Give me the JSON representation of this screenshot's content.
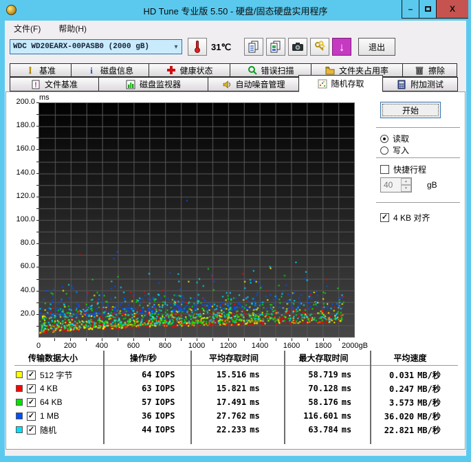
{
  "window": {
    "title": "HD Tune 专业版 5.50 - 硬盘/固态硬盘实用程序"
  },
  "titlebar_controls": {
    "minimize": "–",
    "maximize": "",
    "close": "X"
  },
  "menu": {
    "file": "文件(F)",
    "help": "帮助(H)"
  },
  "toolbar": {
    "drive_select_value": "WDC WD20EARX-00PASB0 (2000 gB)",
    "temperature": "31℃",
    "exit_label": "退出",
    "icons": [
      "thermometer-icon",
      "copy-text-icon",
      "copy-image-icon",
      "camera-icon",
      "keys-icon",
      "download-arrow-icon"
    ]
  },
  "tabs": {
    "row1": [
      {
        "label": "基准",
        "icon": "exclamation-icon"
      },
      {
        "label": "磁盘信息",
        "icon": "info-icon"
      },
      {
        "label": "健康状态",
        "icon": "health-cross-icon"
      },
      {
        "label": "错误扫描",
        "icon": "magnifier-icon"
      },
      {
        "label": "文件夹占用率",
        "icon": "folder-icon"
      },
      {
        "label": "擦除",
        "icon": "trash-icon"
      }
    ],
    "row2": [
      {
        "label": "文件基准",
        "icon": "file-benchmark-icon",
        "active": false
      },
      {
        "label": "磁盘监视器",
        "icon": "bar-chart-icon",
        "active": false
      },
      {
        "label": "自动噪音管理",
        "icon": "speaker-icon",
        "active": false
      },
      {
        "label": "随机存取",
        "icon": "scatter-icon",
        "active": true
      },
      {
        "label": "附加测试",
        "icon": "calculator-icon",
        "active": false
      }
    ]
  },
  "controls": {
    "start_label": "开始",
    "read_label": "读取",
    "read_selected": true,
    "write_label": "写入",
    "write_selected": false,
    "shortstroke_label": "快捷行程",
    "shortstroke_checked": false,
    "shortstroke_value": "40",
    "shortstroke_unit": "gB",
    "align_label": "4 KB 对齐",
    "align_checked": true,
    "check_glyph": "✓",
    "spin_up": "▲",
    "spin_down": "▼"
  },
  "chart_data": {
    "type": "scatter",
    "title": "随机存取 access time vs disk position",
    "xlabel": "gB",
    "ylabel": "ms",
    "xlim": [
      0,
      2000
    ],
    "ylim": [
      0,
      200
    ],
    "grid": true,
    "grid_step_x": 100,
    "grid_step_y": 10,
    "x_ticks": [
      0,
      200,
      400,
      600,
      800,
      1000,
      1200,
      1400,
      1600,
      1800,
      2000
    ],
    "x_tick_labels": [
      "0",
      "200",
      "400",
      "600",
      "800",
      "1000",
      "1200",
      "1400",
      "1600",
      "1800",
      "2000gB"
    ],
    "y_ticks": [
      20,
      40,
      60,
      80,
      100,
      120,
      140,
      160,
      180,
      200
    ],
    "y_tick_labels": [
      "20.0",
      "40.0",
      "60.0",
      "80.0",
      "100.0",
      "120.0",
      "140.0",
      "160.0",
      "180.0",
      "200.0"
    ],
    "background": {
      "top": "#020202",
      "bottom": "#474747",
      "gridline": "#585858"
    },
    "envelope": {
      "base_ms": 1.5,
      "rise_ms": 10.5
    },
    "series": [
      {
        "name": "512 字节",
        "color": "#ffff00",
        "iops": 64,
        "avg_ms": 15.516,
        "max_ms": 58.719,
        "speed_mb_s": 0.031,
        "count": 430,
        "offset": 0.6,
        "tail": 6.8,
        "seed": 11
      },
      {
        "name": "4 KB",
        "color": "#ff0000",
        "iops": 63,
        "avg_ms": 15.821,
        "max_ms": 70.128,
        "speed_mb_s": 0.247,
        "count": 420,
        "offset": 0.2,
        "tail": 7.3,
        "seed": 22
      },
      {
        "name": "64 KB",
        "color": "#00e400",
        "iops": 57,
        "avg_ms": 17.491,
        "max_ms": 58.176,
        "speed_mb_s": 3.573,
        "count": 420,
        "offset": 2.2,
        "tail": 7.0,
        "seed": 33
      },
      {
        "name": "随机",
        "color": "#00e0ff",
        "iops": 44,
        "avg_ms": 22.233,
        "max_ms": 63.784,
        "speed_mb_s": 22.821,
        "count": 330,
        "offset": 2.5,
        "tail": 11.5,
        "seed": 55
      },
      {
        "name": "1 MB",
        "color": "#0050ff",
        "iops": 36,
        "avg_ms": 27.762,
        "max_ms": 116.601,
        "speed_mb_s": 36.02,
        "count": 310,
        "offset": 13.0,
        "tail": 7.0,
        "seed": 44
      }
    ]
  },
  "table": {
    "headers": [
      "传输数据大小",
      "操作/秒",
      "平均存取时间",
      "最大存取时间",
      "平均速度"
    ],
    "units": {
      "iops": "IOPS",
      "ms": "ms",
      "speed": "MB/秒"
    },
    "rows": [
      {
        "color": "#ffff00",
        "checked": true,
        "label": "512 字节",
        "iops": "64",
        "avg": "15.516",
        "max": "58.719",
        "speed": "0.031"
      },
      {
        "color": "#ff0000",
        "checked": true,
        "label": "4 KB",
        "iops": "63",
        "avg": "15.821",
        "max": "70.128",
        "speed": "0.247"
      },
      {
        "color": "#00e400",
        "checked": true,
        "label": "64 KB",
        "iops": "57",
        "avg": "17.491",
        "max": "58.176",
        "speed": "3.573"
      },
      {
        "color": "#0050ff",
        "checked": true,
        "label": "1 MB",
        "iops": "36",
        "avg": "27.762",
        "max": "116.601",
        "speed": "36.020"
      },
      {
        "color": "#00e0ff",
        "checked": true,
        "label": "随机",
        "iops": "44",
        "avg": "22.233",
        "max": "63.784",
        "speed": "22.821"
      }
    ]
  }
}
